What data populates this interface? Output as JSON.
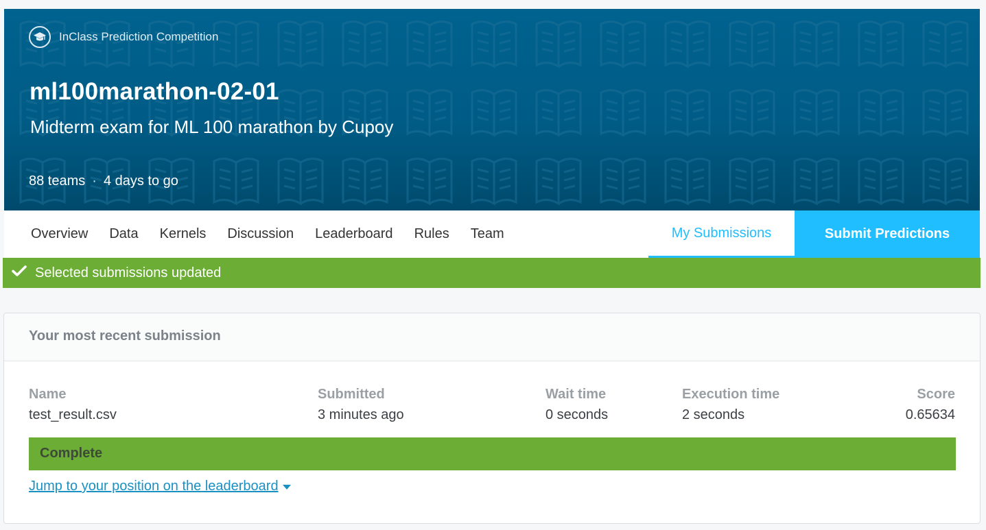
{
  "banner": {
    "competition_type": "InClass Prediction Competition",
    "type_icon": "graduation-cap-icon",
    "title": "ml100marathon-02-01",
    "subtitle": "Midterm exam for ML 100 marathon by Cupoy",
    "teams": "88 teams",
    "separator": "·",
    "deadline": "4 days to go",
    "background_color": "#00628f"
  },
  "nav": {
    "tabs": [
      {
        "label": "Overview"
      },
      {
        "label": "Data"
      },
      {
        "label": "Kernels"
      },
      {
        "label": "Discussion"
      },
      {
        "label": "Leaderboard"
      },
      {
        "label": "Rules"
      },
      {
        "label": "Team"
      }
    ],
    "my_submissions": "My Submissions",
    "submit_predictions": "Submit Predictions",
    "accent_color": "#20beff"
  },
  "notice": {
    "icon": "checkmark-icon",
    "text": "Selected submissions updated",
    "color": "#6cad36"
  },
  "submission": {
    "heading": "Your most recent submission",
    "columns": {
      "name": {
        "label": "Name",
        "value": "test_result.csv"
      },
      "submitted": {
        "label": "Submitted",
        "value": "3 minutes ago"
      },
      "wait": {
        "label": "Wait time",
        "value": "0 seconds"
      },
      "execution": {
        "label": "Execution time",
        "value": "2 seconds"
      },
      "score": {
        "label": "Score",
        "value": "0.65634"
      }
    },
    "status": "Complete",
    "jump_link": "Jump to your position on the leaderboard"
  }
}
